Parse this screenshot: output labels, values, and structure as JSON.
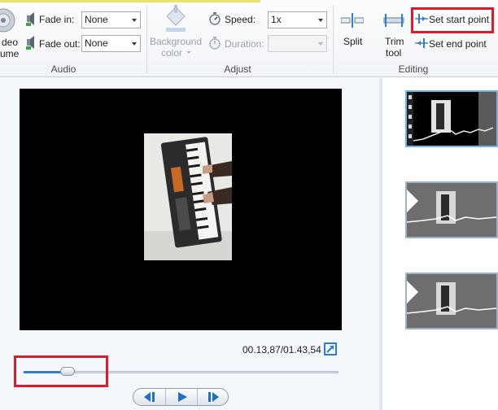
{
  "ribbon": {
    "video_volume_label": [
      "deo",
      "ume"
    ],
    "audio": {
      "group_label": "Audio",
      "fade_in_label": "Fade in:",
      "fade_in_value": "None",
      "fade_out_label": "Fade out:",
      "fade_out_value": "None"
    },
    "adjust": {
      "group_label": "Adjust",
      "background_color_label": [
        "Background",
        "color"
      ],
      "speed_label": "Speed:",
      "speed_value": "1x",
      "duration_label": "Duration:",
      "duration_value": ""
    },
    "editing": {
      "group_label": "Editing",
      "split_label": "Split",
      "trim_tool_label": [
        "Trim",
        "tool"
      ],
      "set_start_point_label": "Set start point",
      "set_end_point_label": "Set end point"
    }
  },
  "preview": {
    "timecode": "00.13,87/01.43,54",
    "seek_progress": 0.13
  },
  "storyboard": {
    "clip_count": 3,
    "selected_clip": 0
  },
  "colors": {
    "accent": "#2f7ed8",
    "highlight": "#e0192b"
  }
}
